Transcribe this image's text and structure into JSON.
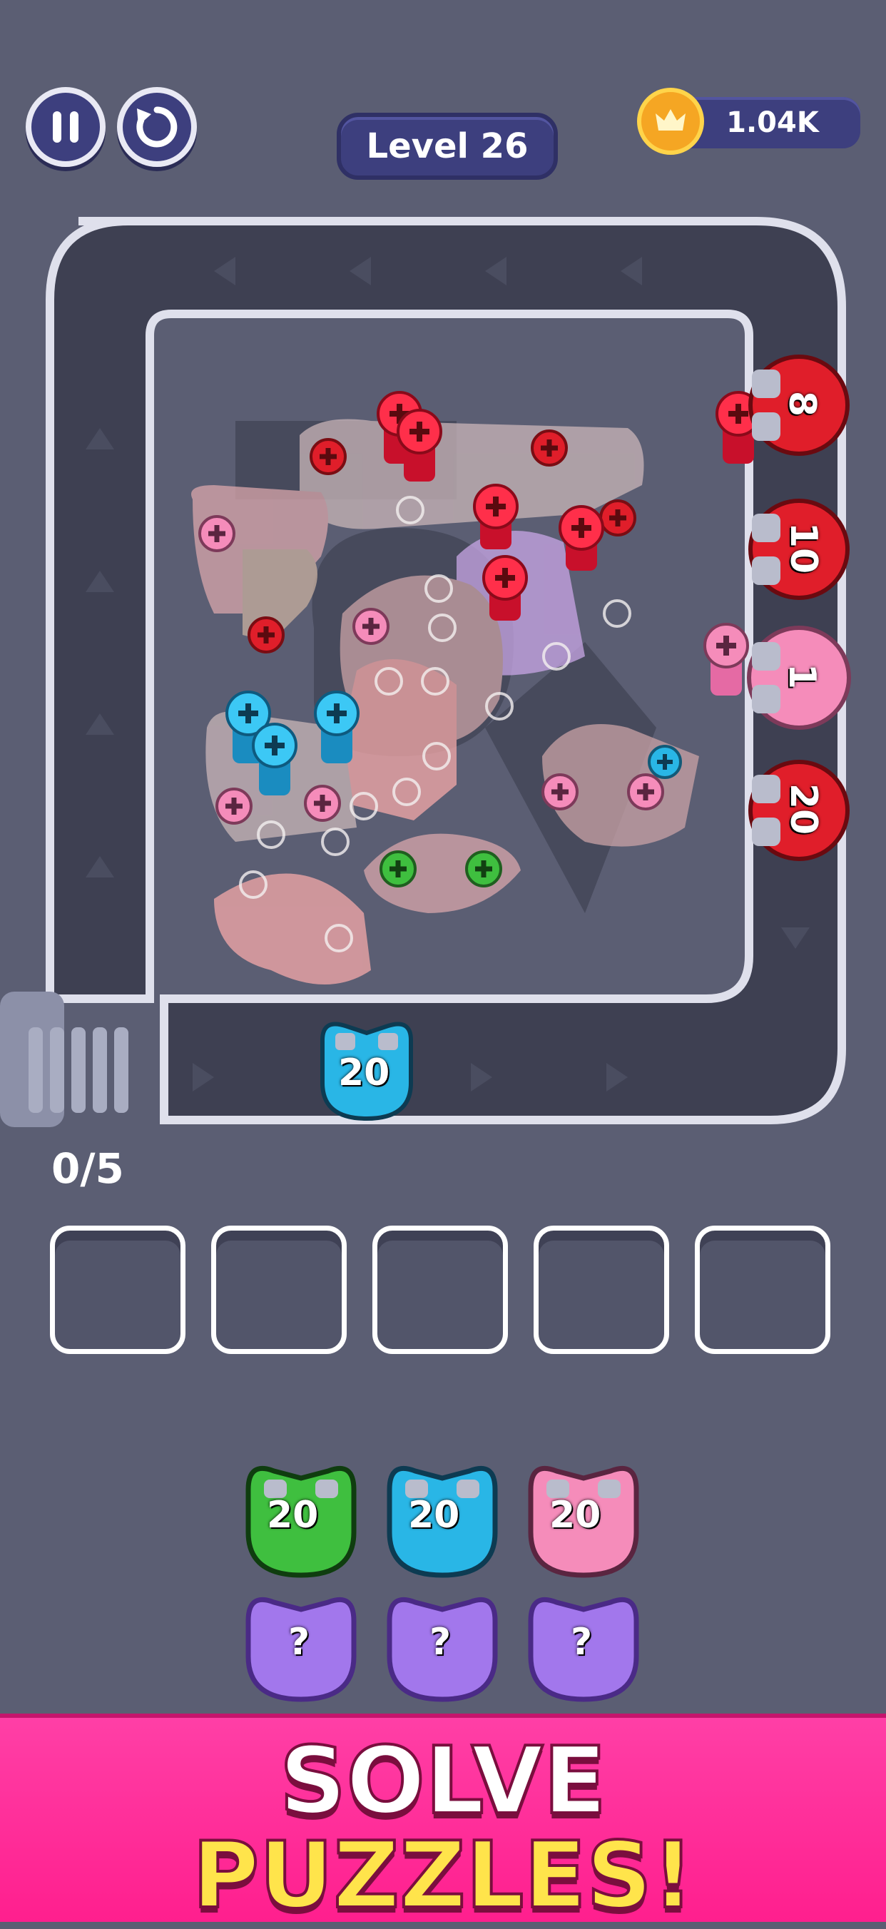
{
  "header": {
    "pause_icon": "pause-icon",
    "restart_icon": "restart-icon",
    "level_label": "Level 26",
    "coins": "1.04K",
    "coin_icon": "coin-icon"
  },
  "board": {
    "conveyor_magnets": [
      {
        "label": "8",
        "color": "#e01e2a"
      },
      {
        "label": "10",
        "color": "#e01e2a"
      },
      {
        "label": "1",
        "color": "#f58cba"
      },
      {
        "label": "20",
        "color": "#e01e2a"
      }
    ],
    "active_magnet": {
      "label": "20",
      "color": "#29b6e6"
    }
  },
  "progress": {
    "counter": "0/5"
  },
  "queue": {
    "magnets": [
      {
        "label": "20",
        "color": "#3fbf3f"
      },
      {
        "label": "20",
        "color": "#29b6e6"
      },
      {
        "label": "20",
        "color": "#f58cba"
      }
    ],
    "mystery": [
      {
        "label": "?"
      },
      {
        "label": "?"
      },
      {
        "label": "?"
      }
    ]
  },
  "banner": {
    "line1": "SOLVE",
    "line2": "PUZZLES!"
  },
  "colors": {
    "background": "#5b5e73",
    "pill": "#3d3f7e",
    "red": "#e01e2a",
    "blue": "#29b6e6",
    "pink": "#f58cba",
    "green": "#3fbf3f",
    "purple": "#a277ec",
    "banner": "#ff2c97"
  }
}
